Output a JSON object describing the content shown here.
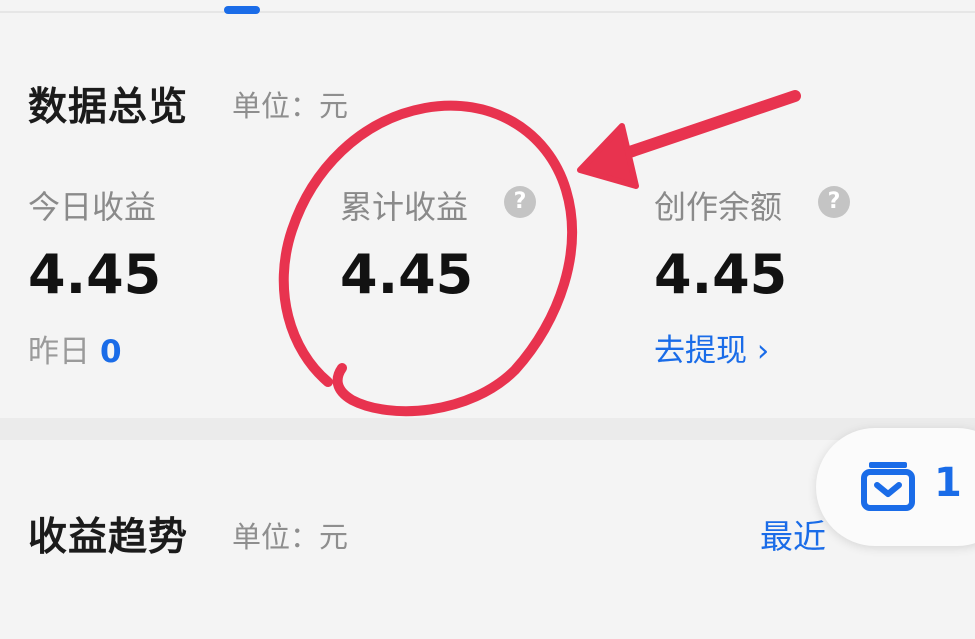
{
  "overview": {
    "title": "数据总览",
    "unit": "单位：元",
    "stats": [
      {
        "label": "今日收益",
        "value": "4.45",
        "sub_label": "昨日",
        "sub_value": "0"
      },
      {
        "label": "累计收益",
        "value": "4.45",
        "help_icon": "?"
      },
      {
        "label": "创作余额",
        "value": "4.45",
        "help_icon": "?",
        "link": "去提现 ›"
      }
    ]
  },
  "trend": {
    "title": "收益趋势",
    "unit": "单位：元",
    "range_label": "最近"
  },
  "floating_badge": {
    "count": "1",
    "icon": "inbox-icon"
  },
  "colors": {
    "accent": "#1a6ce8",
    "annotation": "#e8334f",
    "background": "#f4f4f4"
  }
}
